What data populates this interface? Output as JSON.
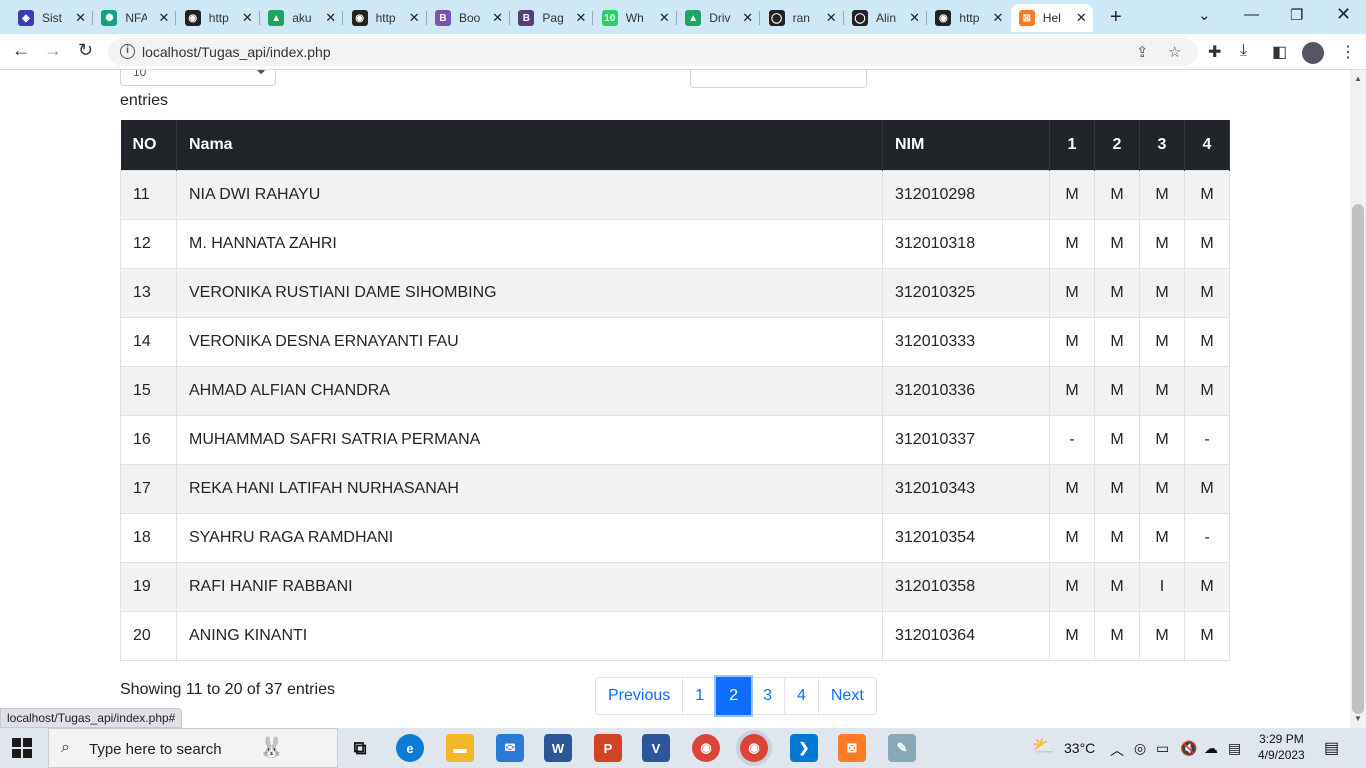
{
  "browser": {
    "tabs": [
      {
        "title": "Sist",
        "color": "#3b3bb3",
        "glyph": "◈"
      },
      {
        "title": "NFA",
        "color": "#10a37f",
        "glyph": "✺"
      },
      {
        "title": "http",
        "color": "#222222",
        "glyph": "◉"
      },
      {
        "title": "aku",
        "color": "#1fa463",
        "glyph": "▲"
      },
      {
        "title": "http",
        "color": "#222222",
        "glyph": "◉"
      },
      {
        "title": "Boo",
        "color": "#7952b3",
        "glyph": "B"
      },
      {
        "title": "Pag",
        "color": "#563d7c",
        "glyph": "B"
      },
      {
        "title": "Wh",
        "color": "#25d366",
        "glyph": "10"
      },
      {
        "title": "Driv",
        "color": "#1fa463",
        "glyph": "▲"
      },
      {
        "title": "ran",
        "color": "#222222",
        "glyph": "◯"
      },
      {
        "title": "Alin",
        "color": "#222222",
        "glyph": "◯"
      },
      {
        "title": "http",
        "color": "#222222",
        "glyph": "◉"
      },
      {
        "title": "Hel",
        "color": "#fb7a24",
        "glyph": "⊠"
      }
    ],
    "url": "localhost/Tugas_api/index.php",
    "status_url": "localhost/Tugas_api/index.php#"
  },
  "page": {
    "length_value": "10",
    "entries_label": "entries",
    "table": {
      "headers": [
        "NO",
        "Nama",
        "NIM",
        "1",
        "2",
        "3",
        "4"
      ],
      "rows": [
        [
          "11",
          "NIA DWI RAHAYU",
          "312010298",
          "M",
          "M",
          "M",
          "M"
        ],
        [
          "12",
          "M. HANNATA ZAHRI",
          "312010318",
          "M",
          "M",
          "M",
          "M"
        ],
        [
          "13",
          "VERONIKA RUSTIANI DAME SIHOMBING",
          "312010325",
          "M",
          "M",
          "M",
          "M"
        ],
        [
          "14",
          "VERONIKA DESNA ERNAYANTI FAU",
          "312010333",
          "M",
          "M",
          "M",
          "M"
        ],
        [
          "15",
          "AHMAD ALFIAN CHANDRA",
          "312010336",
          "M",
          "M",
          "M",
          "M"
        ],
        [
          "16",
          "MUHAMMAD SAFRI SATRIA PERMANA",
          "312010337",
          "-",
          "M",
          "M",
          "-"
        ],
        [
          "17",
          "REKA HANI LATIFAH NURHASANAH",
          "312010343",
          "M",
          "M",
          "M",
          "M"
        ],
        [
          "18",
          "SYAHRU RAGA RAMDHANI",
          "312010354",
          "M",
          "M",
          "M",
          "-"
        ],
        [
          "19",
          "RAFI HANIF RABBANI",
          "312010358",
          "M",
          "M",
          "I",
          "M"
        ],
        [
          "20",
          "ANING KINANTI",
          "312010364",
          "M",
          "M",
          "M",
          "M"
        ]
      ]
    },
    "info": "Showing 11 to 20 of 37 entries",
    "pagination": {
      "previous": "Previous",
      "pages": [
        "1",
        "2",
        "3",
        "4"
      ],
      "active": "2",
      "next": "Next"
    }
  },
  "taskbar": {
    "search_placeholder": "Type here to search",
    "temperature": "33°C",
    "time": "3:29 PM",
    "date": "4/9/2023"
  }
}
